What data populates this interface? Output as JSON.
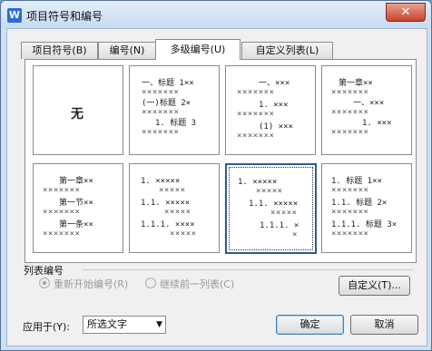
{
  "window": {
    "title": "项目符号和编号",
    "app_icon": "W",
    "close_glyph": "✕"
  },
  "tabs": [
    "项目符号(B)",
    "编号(N)",
    "多级编号(U)",
    "自定义列表(L)"
  ],
  "presets": {
    "none": "无",
    "p2": [
      "一、标题 1××",
      "×××××××",
      "(一)标题 2×",
      "×××××××",
      "1. 标题 3",
      "×××××××"
    ],
    "p3": [
      "一、×××",
      "×××××××",
      "1. ×××",
      "×××××××",
      "(1) ×××",
      "×××××××"
    ],
    "p4": [
      "第一章××",
      "×××××××",
      "一、×××",
      "×××××××",
      "1. ×××",
      "×××××××"
    ],
    "p5": [
      "第一章××",
      "×××××××",
      "第一节××",
      "×××××××",
      "第一条××",
      "×××××××"
    ],
    "p6": [
      "1. ×××××",
      "×××××",
      "1.1. ×××××",
      "×××××",
      "1.1.1. ××××",
      "×××××"
    ],
    "p7": [
      "1. ×××××",
      "×××××",
      "1.1. ×××××",
      "×××××",
      "1.1.1. ×",
      "×"
    ],
    "p8": [
      "1. 标题 1××",
      "×××××××",
      "1.1. 标题 2×",
      "×××××××",
      "1.1.1. 标题 3×",
      "×××××××"
    ]
  },
  "list_numbering": {
    "label": "列表编号",
    "restart_label": "重新开始编号(R)",
    "continue_label": "继续前一列表(C)",
    "customize_button": "自定义(T)..."
  },
  "apply_to": {
    "label": "应用于(Y):",
    "value": "所选文字",
    "arrow": "▼"
  },
  "buttons": {
    "ok": "确定",
    "cancel": "取消"
  }
}
